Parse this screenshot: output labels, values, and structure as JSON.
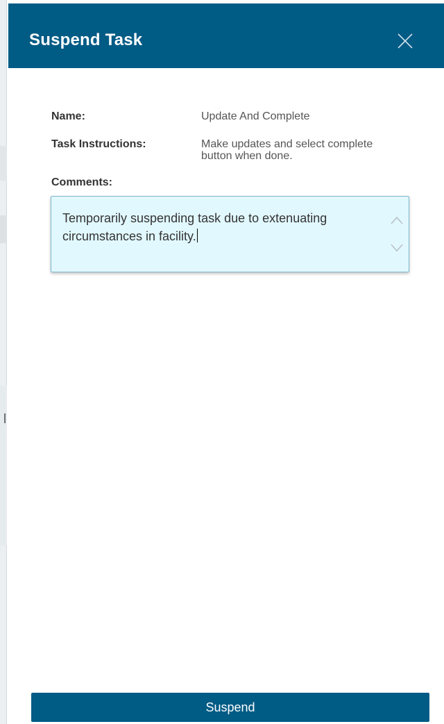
{
  "dialog": {
    "title": "Suspend Task"
  },
  "fields": {
    "name_label": "Name:",
    "name_value": "Update And Complete",
    "instructions_label": "Task Instructions:",
    "instructions_value": "Make updates and select complete button when done.",
    "comments_label": "Comments:",
    "comments_value": "Temporarily suspending task due to extenuating circumstances in facility."
  },
  "actions": {
    "suspend_label": "Suspend"
  },
  "colors": {
    "header_bg": "#005b85",
    "button_bg": "#005b85",
    "comments_bg": "#e1f8fe"
  },
  "icons": {
    "close": "close-icon",
    "scroll_up": "chevron-up-icon",
    "scroll_down": "chevron-down-icon"
  }
}
